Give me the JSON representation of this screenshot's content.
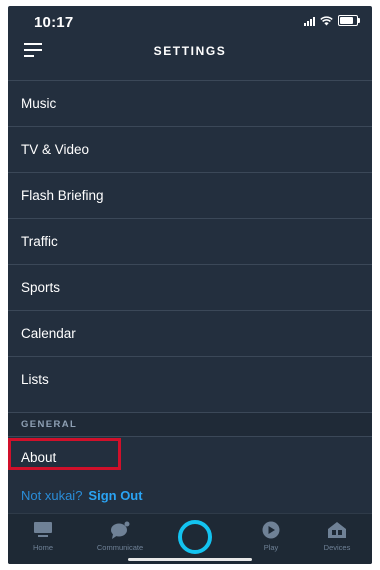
{
  "status": {
    "time": "10:17",
    "battery_level": 0.8
  },
  "header": {
    "title": "SETTINGS",
    "menu_icon": "hamburger-menu-icon"
  },
  "settings_items": [
    "Music",
    "TV & Video",
    "Flash Briefing",
    "Traffic",
    "Sports",
    "Calendar",
    "Lists"
  ],
  "general": {
    "header": "GENERAL",
    "about": "About"
  },
  "account": {
    "not_user": "Not xukai?",
    "sign_out": "Sign Out"
  },
  "bottom_nav": {
    "home": "Home",
    "communicate": "Communicate",
    "play": "Play",
    "devices": "Devices"
  },
  "colors": {
    "background": "#232f3e",
    "accent": "#13c3f0",
    "link": "#2aa4f4",
    "highlight": "#d0102a"
  }
}
